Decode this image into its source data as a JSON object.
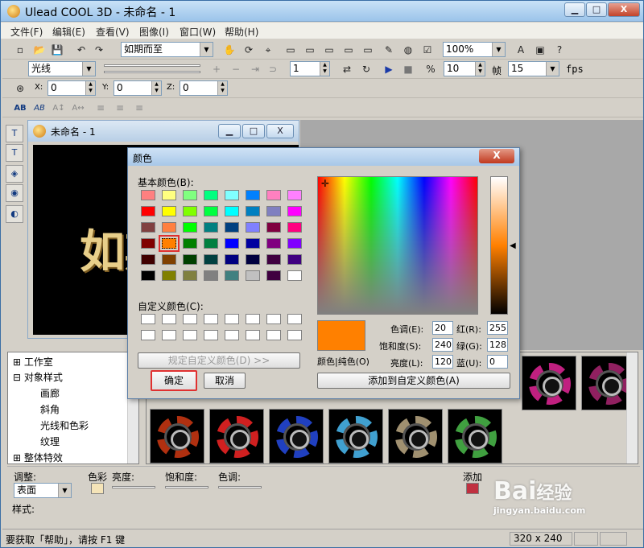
{
  "app": {
    "title": "Ulead COOL 3D - 未命名 - 1"
  },
  "window_controls": {
    "minimize": "▁",
    "maximize": "□",
    "close": "X"
  },
  "menu": [
    "文件(F)",
    "编辑(E)",
    "查看(V)",
    "图像(I)",
    "窗口(W)",
    "帮助(H)"
  ],
  "toolbar1": {
    "text_combo": "如期而至",
    "zoom": "100%"
  },
  "toolbar2": {
    "effect_combo": "光线",
    "frame": "1",
    "frames_label": "帧",
    "frame_count": "10",
    "fps_value": "15",
    "fps_label": "fps"
  },
  "toolbar3": {
    "x_label": "X:",
    "x": "0",
    "y_label": "Y:",
    "y": "0",
    "z_label": "Z:",
    "z": "0"
  },
  "child": {
    "title": "未命名 - 1",
    "preview_text": "如期"
  },
  "dialog": {
    "title": "颜色",
    "basic_label": "基本颜色(B):",
    "custom_label": "自定义颜色(C):",
    "define_button": "规定自定义颜色(D) >>",
    "ok_button": "确定",
    "cancel_button": "取消",
    "solid_label": "颜色|纯色(O)",
    "hue_label": "色调(E):",
    "hue": "20",
    "sat_label": "饱和度(S):",
    "sat": "240",
    "lum_label": "亮度(L):",
    "lum": "120",
    "red_label": "红(R):",
    "red": "255",
    "green_label": "绿(G):",
    "green": "128",
    "blue_label": "蓝(U):",
    "blue": "0",
    "add_button": "添加到自定义颜色(A)",
    "selected_color": "#ff8000"
  },
  "basic_colors": [
    [
      "#ff8080",
      "#ffff80",
      "#80ff80",
      "#00ff80",
      "#80ffff",
      "#0080ff",
      "#ff80c0",
      "#ff80ff"
    ],
    [
      "#ff0000",
      "#ffff00",
      "#80ff00",
      "#00ff40",
      "#00ffff",
      "#0080c0",
      "#8080c0",
      "#ff00ff"
    ],
    [
      "#804040",
      "#ff8040",
      "#00ff00",
      "#008080",
      "#004080",
      "#8080ff",
      "#800040",
      "#ff0080"
    ],
    [
      "#800000",
      "#ff8000",
      "#008000",
      "#008040",
      "#0000ff",
      "#0000a0",
      "#800080",
      "#8000ff"
    ],
    [
      "#400000",
      "#804000",
      "#004000",
      "#004040",
      "#000080",
      "#000040",
      "#400040",
      "#400080"
    ],
    [
      "#000000",
      "#808000",
      "#808040",
      "#808080",
      "#408080",
      "#c0c0c0",
      "#400040",
      "#ffffff"
    ]
  ],
  "tree": [
    "工作室",
    "对象样式",
    "画廊",
    "斜角",
    "光线和色彩",
    "纹理",
    "整体特效"
  ],
  "adjust": {
    "adjust_label": "调整:",
    "surface": "表面",
    "color_label": "色彩",
    "brightness_label": "亮度:",
    "saturation_label": "饱和度:",
    "hue_label": "色调:",
    "add_label": "添加",
    "style_label": "样式:"
  },
  "status": {
    "text": "要获取「帮助」，请按 F1 键",
    "size": "320 x 240"
  },
  "watermark": {
    "brand": "Bai",
    "brand2": "经验",
    "url": "jingyan.baidu.com"
  },
  "thumb_colors": [
    "#b03010",
    "#d02020",
    "#2040c0",
    "#40a0d0",
    "#a09070",
    "#40a040",
    "#c02080",
    "#902060"
  ]
}
